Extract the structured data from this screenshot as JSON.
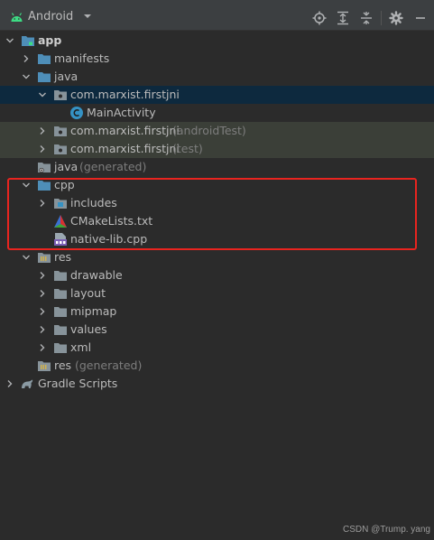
{
  "toolbar": {
    "view_label": "Android",
    "buttons": [
      "locate-icon",
      "expand-all-icon",
      "collapse-all-icon",
      "gear-icon",
      "minimize-icon"
    ]
  },
  "tree": {
    "app": "app",
    "manifests": "manifests",
    "java": "java",
    "pkg_main": "com.marxist.firstjni",
    "main_activity": "MainActivity",
    "pkg_android_test": "com.marxist.firstjni",
    "pkg_android_test_suffix": "(androidTest)",
    "pkg_test": "com.marxist.firstjni",
    "pkg_test_suffix": "(test)",
    "java_generated": "java",
    "java_generated_suffix": "(generated)",
    "cpp": "cpp",
    "includes": "includes",
    "cmakelists": "CMakeLists.txt",
    "native_lib": "native-lib.cpp",
    "res": "res",
    "drawable": "drawable",
    "layout": "layout",
    "mipmap": "mipmap",
    "values": "values",
    "xml": "xml",
    "res_generated": "res",
    "res_generated_suffix": "(generated)",
    "gradle_scripts": "Gradle Scripts"
  },
  "watermark": "CSDN @Trump. yang",
  "colors": {
    "background": "#2b2b2b",
    "toolbar": "#3c3f41",
    "selected_row": "#0d293e",
    "test_row": "#3b3f38",
    "folder_blue": "#4e8eb8",
    "highlight_box": "#e8241f"
  }
}
